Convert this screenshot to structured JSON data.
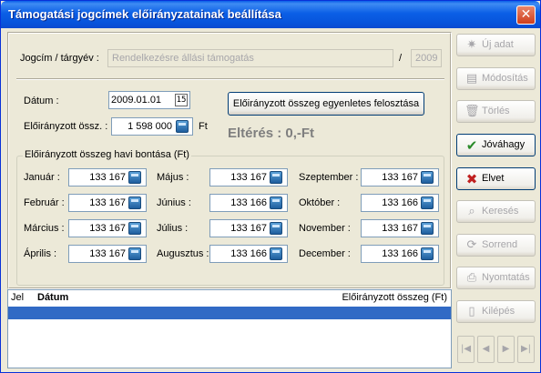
{
  "window": {
    "title": "Támogatási jogcímek előirányzatainak beállítása",
    "close_glyph": "✕"
  },
  "header": {
    "jogcim_label": "Jogcím / tárgyév :",
    "jogcim_value": "Rendelkezésre állási támogatás",
    "slash": "/",
    "year_value": "2009"
  },
  "datum": {
    "label": "Dátum :",
    "value": "2009.01.01",
    "calendar_glyph": "15"
  },
  "eloirany": {
    "label": "Előirányzott össz. :",
    "value": "1 598 000",
    "unit": "Ft"
  },
  "distribute_button": "Előirányzott összeg egyenletes felosztása",
  "difference": "Eltérés : 0,-Ft",
  "monthly_group_title": "Előirányzott összeg havi bontása (Ft)",
  "months": [
    {
      "label": "Január :",
      "value": "133 167"
    },
    {
      "label": "Február :",
      "value": "133 167"
    },
    {
      "label": "Március :",
      "value": "133 167"
    },
    {
      "label": "Április :",
      "value": "133 167"
    },
    {
      "label": "Május :",
      "value": "133 167"
    },
    {
      "label": "Június :",
      "value": "133 166"
    },
    {
      "label": "Július :",
      "value": "133 167"
    },
    {
      "label": "Augusztus :",
      "value": "133 166"
    },
    {
      "label": "Szeptember :",
      "value": "133 167"
    },
    {
      "label": "Október :",
      "value": "133 166"
    },
    {
      "label": "November :",
      "value": "133 167"
    },
    {
      "label": "December :",
      "value": "133 166"
    }
  ],
  "sidebar": {
    "new": "Új adat",
    "modify": "Módosítás",
    "delete": "Törlés",
    "approve": "Jóváhagy",
    "reject": "Elvet",
    "search": "Keresés",
    "order": "Sorrend",
    "print": "Nyomtatás",
    "exit": "Kilépés"
  },
  "nav": {
    "first": "|◀",
    "prev": "◀",
    "next": "▶",
    "last": "▶|"
  },
  "grid": {
    "columns": [
      "Jel",
      "Dátum",
      "Előirányzott összeg (Ft)"
    ]
  }
}
